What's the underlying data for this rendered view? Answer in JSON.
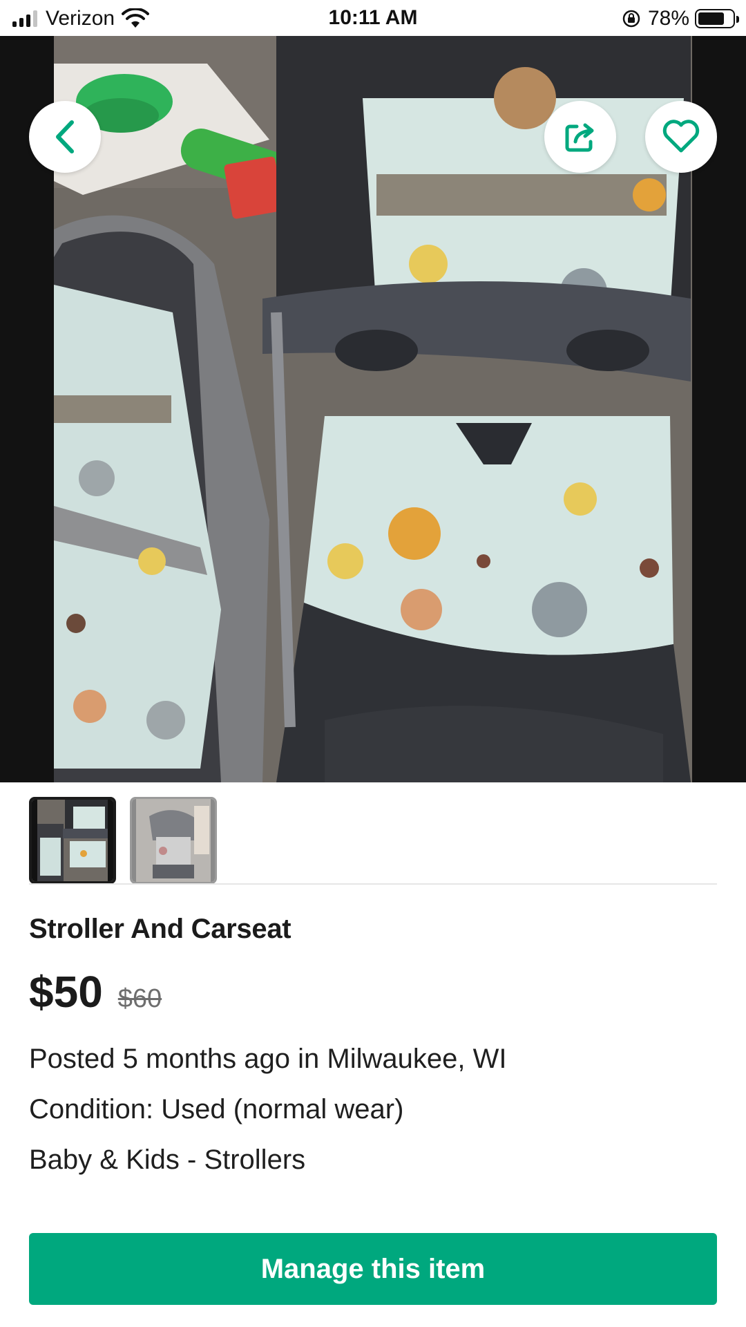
{
  "status_bar": {
    "carrier": "Verizon",
    "time": "10:11 AM",
    "battery_percent": "78%",
    "battery_level": 0.78,
    "signal_bars": 3,
    "signal_bars_total": 4
  },
  "hero": {
    "image_description_icon": "stroller-photo",
    "back_icon": "chevron-left-icon",
    "share_icon": "share-icon",
    "favorite_icon": "heart-outline-icon",
    "selected_thumbnail_index": 0
  },
  "thumbnails": [
    {
      "icon": "stroller-thumbnail",
      "selected": true
    },
    {
      "icon": "stroller-thumbnail-2",
      "selected": false
    }
  ],
  "item": {
    "title": "Stroller And Carseat",
    "price": "$50",
    "original_price": "$60",
    "posted": "Posted 5 months ago in Milwaukee, WI",
    "condition": "Condition: Used (normal wear)",
    "category": "Baby & Kids - Strollers"
  },
  "actions": {
    "manage_label": "Manage this item"
  },
  "colors": {
    "accent": "#00a87e",
    "text": "#1b1b1b",
    "muted": "#6e6e6e"
  }
}
